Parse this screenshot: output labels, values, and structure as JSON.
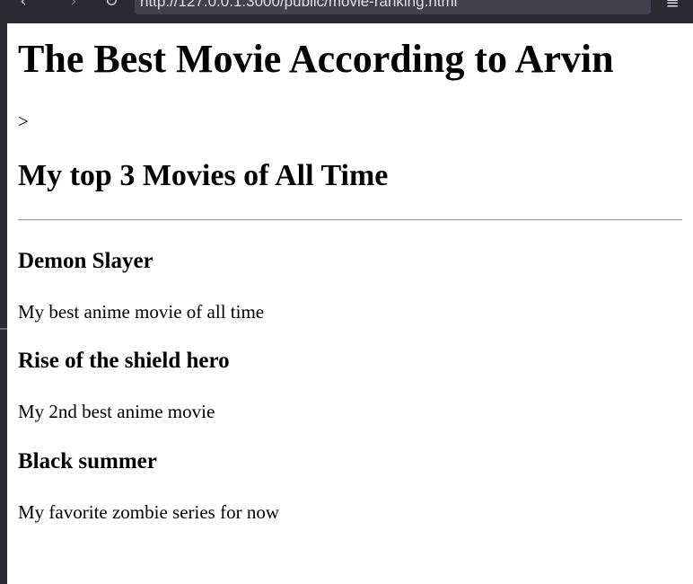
{
  "browser": {
    "back_icon": "arrow-left-icon",
    "forward_icon": "arrow-right-icon",
    "reload_icon": "reload-icon",
    "menu_icon": "hamburger-menu-icon",
    "url": "http://127.0.0.1:3000/public/movie-ranking.html",
    "theme_color": "#2b2a33",
    "url_bar_color": "#42414d"
  },
  "page": {
    "title": "The Best Movie According to Arvin",
    "stray_text": ">",
    "subtitle": "My top 3 Movies of All Time",
    "movies": [
      {
        "title": "Demon Slayer",
        "description": "My best anime movie of all time"
      },
      {
        "title": "Rise of the shield hero",
        "description": "My 2nd best anime movie"
      },
      {
        "title": "Black summer",
        "description": "My favorite zombie series for now"
      }
    ]
  }
}
